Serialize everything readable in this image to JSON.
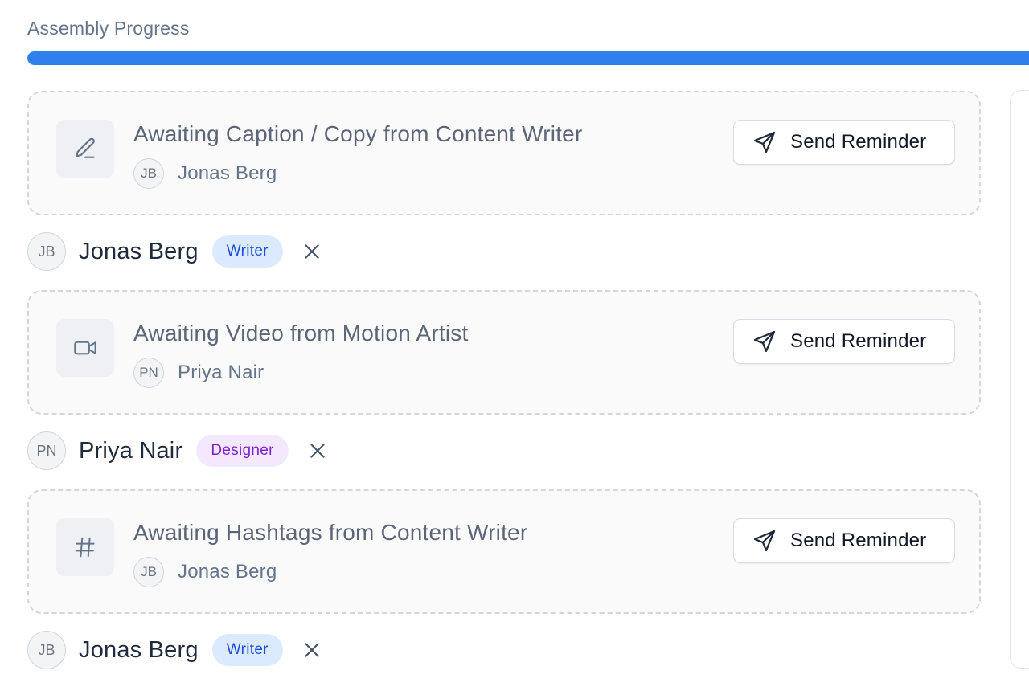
{
  "progress": {
    "label": "Assembly Progress",
    "fraction": 1.0,
    "color": "#2f80ed"
  },
  "cards": [
    {
      "icon": "pencil-icon",
      "title": "Awaiting Caption / Copy from Content Writer",
      "assignee_initials": "JB",
      "assignee_name": "Jonas Berg",
      "button_label": "Send Reminder"
    },
    {
      "icon": "video-camera-icon",
      "title": "Awaiting Video from Motion Artist",
      "assignee_initials": "PN",
      "assignee_name": "Priya Nair",
      "button_label": "Send Reminder"
    },
    {
      "icon": "hashtag-icon",
      "title": "Awaiting Hashtags from Content Writer",
      "assignee_initials": "JB",
      "assignee_name": "Jonas Berg",
      "button_label": "Send Reminder"
    }
  ],
  "assignees": [
    {
      "initials": "JB",
      "name": "Jonas Berg",
      "role": "Writer"
    },
    {
      "initials": "PN",
      "name": "Priya Nair",
      "role": "Designer"
    },
    {
      "initials": "JB",
      "name": "Jonas Berg",
      "role": "Writer"
    }
  ]
}
